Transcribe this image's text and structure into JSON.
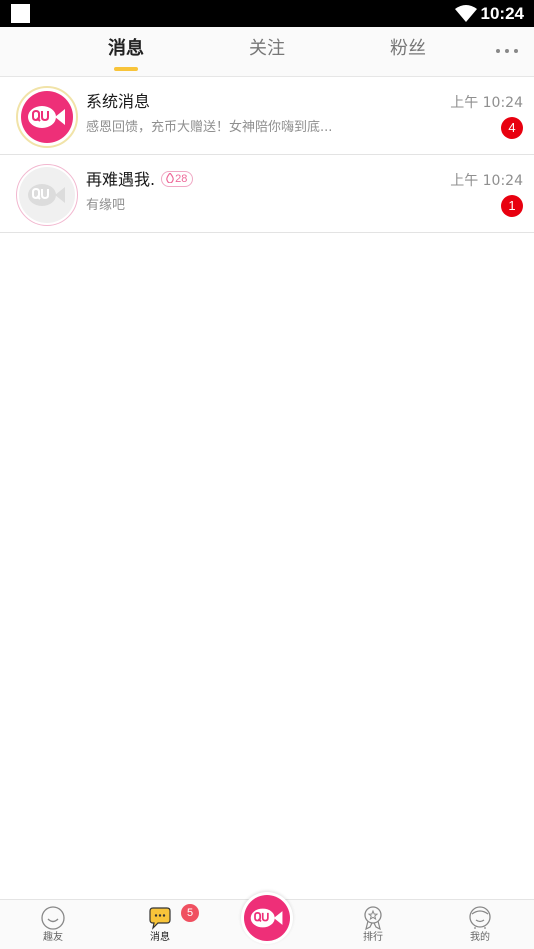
{
  "status_bar": {
    "time": "10:24"
  },
  "tabs": [
    {
      "label": "消息",
      "active": true
    },
    {
      "label": "关注",
      "active": false
    },
    {
      "label": "粉丝",
      "active": false
    }
  ],
  "conversations": [
    {
      "title": "系统消息",
      "preview": "感恩回馈，充币大赠送！女神陪你嗨到底...",
      "time": "上午 10:24",
      "unread": "4"
    },
    {
      "title": "再难遇我.",
      "level": "28",
      "preview": "有缘吧",
      "time": "上午 10:24",
      "unread": "1"
    }
  ],
  "bottom_nav": {
    "items": [
      {
        "label": "趣友"
      },
      {
        "label": "消息",
        "badge": "5"
      },
      {
        "label": "排行"
      },
      {
        "label": "我的"
      }
    ]
  },
  "colors": {
    "accent": "#ee2f78",
    "tab_indicator": "#f8c43a",
    "unread_badge": "#e8000f"
  }
}
